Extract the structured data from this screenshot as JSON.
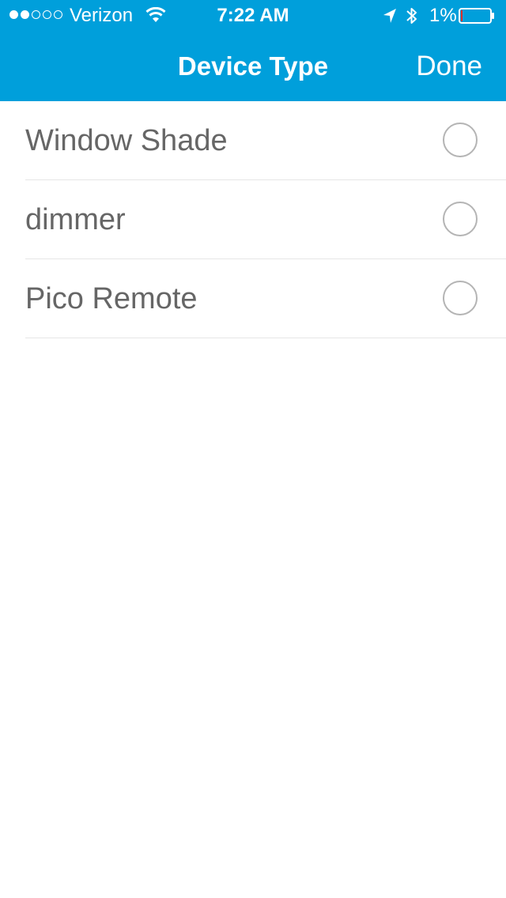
{
  "status_bar": {
    "carrier": "Verizon",
    "time": "7:22 AM",
    "battery_percent": "1%",
    "signal_bars_filled": 2,
    "signal_bars_total": 5,
    "battery_level": 0.01
  },
  "nav": {
    "title": "Device Type",
    "done_label": "Done"
  },
  "device_types": [
    {
      "label": "Window Shade",
      "selected": false
    },
    {
      "label": "dimmer",
      "selected": false
    },
    {
      "label": "Pico Remote",
      "selected": false
    }
  ],
  "icons": {
    "signal": "signal-dots-icon",
    "wifi": "wifi-icon",
    "location": "location-arrow-icon",
    "bluetooth": "bluetooth-icon",
    "battery": "battery-icon",
    "radio": "radio-circle-icon"
  },
  "colors": {
    "header_background": "#009fdb",
    "header_text": "#ffffff",
    "item_text": "#666666",
    "radio_border": "#b4b4b4",
    "divider": "#e6e6e6",
    "battery_low": "#e0302b"
  }
}
